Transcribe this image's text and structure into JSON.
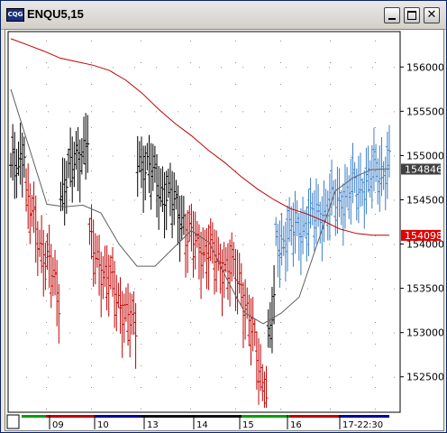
{
  "window": {
    "title": "ENQU5,15",
    "icon": "cqg-app-icon",
    "buttons": [
      "minimize",
      "maximize",
      "close"
    ]
  },
  "chart_data": {
    "type": "bar",
    "instrument": "ENQU5",
    "interval": "15",
    "ylim": [
      1521.0,
      1564.0
    ],
    "y_ticks": [
      {
        "value": 1560.0,
        "label": "156000"
      },
      {
        "value": 1555.0,
        "label": "155500"
      },
      {
        "value": 1550.0,
        "label": "155000"
      },
      {
        "value": 1545.0,
        "label": "154500"
      },
      {
        "value": 1540.0,
        "label": "154000"
      },
      {
        "value": 1535.0,
        "label": "153500"
      },
      {
        "value": 1530.0,
        "label": "153000"
      },
      {
        "value": 1525.0,
        "label": "152500"
      }
    ],
    "x_ticks": [
      "09",
      "10",
      "13",
      "14",
      "15",
      "16",
      "17-22:30"
    ],
    "price_labels": [
      {
        "value": 1548.46,
        "label": "154846",
        "color": "#404040"
      },
      {
        "value": 1540.98,
        "label": "154098",
        "color": "#e00000"
      }
    ],
    "colors": {
      "up": "#3a7fc8",
      "down": "#c00000",
      "neutral": "#000000",
      "ma_slow": "#c00000",
      "ma_fast": "#606060"
    },
    "grid": true,
    "segments": [
      {
        "color": "#000000",
        "start": 1548,
        "end": 1551,
        "n": 8
      },
      {
        "color": "#c00000",
        "start": 1545,
        "end": 1534,
        "n": 18
      },
      {
        "color": "#000000",
        "start": 1546,
        "end": 1552,
        "n": 15
      },
      {
        "color": "#c00000",
        "start": 1540,
        "end": 1530,
        "n": 25
      },
      {
        "color": "#000000",
        "start": 1550,
        "end": 1543,
        "n": 25
      },
      {
        "color": "#c00000",
        "start": 1541,
        "end": 1536,
        "n": 30
      },
      {
        "color": "#c00000",
        "start": 1534,
        "end": 1523,
        "n": 13
      },
      {
        "color": "#000000",
        "start": 1529,
        "end": 1533,
        "n": 4
      },
      {
        "color": "#3a7fc8",
        "start": 1540,
        "end": 1549,
        "n": 60
      }
    ],
    "ma_slow": [
      1563.2,
      1562.5,
      1561.8,
      1561,
      1560.6,
      1560.2,
      1559.6,
      1558.5,
      1557,
      1555.2,
      1553.6,
      1552.2,
      1550.6,
      1549.2,
      1547.6,
      1546.2,
      1545,
      1544,
      1543.4,
      1542.6,
      1541.7,
      1541.2,
      1541.0,
      1541.0
    ],
    "ma_fast": [
      1557.5,
      1551,
      1544.5,
      1544.2,
      1544.4,
      1543.5,
      1540,
      1537.5,
      1537.5,
      1539.5,
      1541.5,
      1540.2,
      1536,
      1532.2,
      1531,
      1532.2,
      1534,
      1540,
      1546,
      1547.5,
      1548.4,
      1548.5
    ]
  }
}
